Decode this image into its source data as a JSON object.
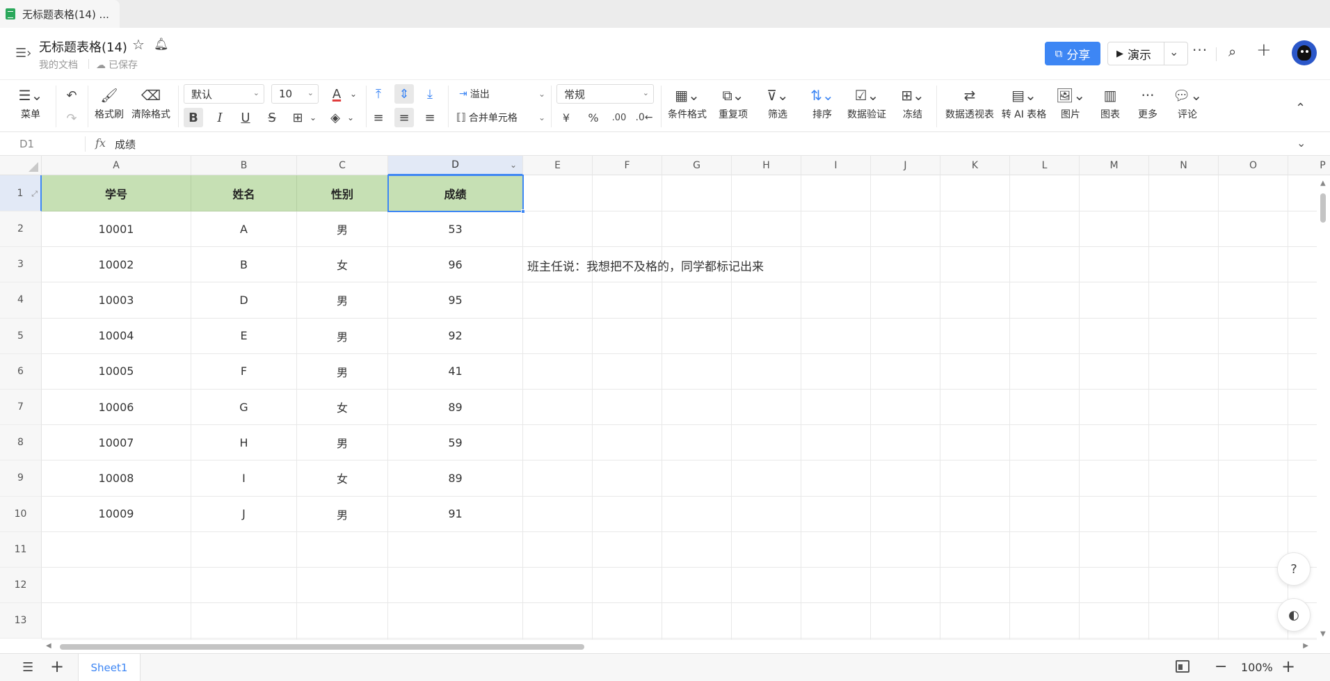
{
  "browser_tab": {
    "title": "无标题表格(14) ..."
  },
  "doc": {
    "title": "无标题表格(14)",
    "breadcrumb": "我的文档",
    "save_status": "已保存"
  },
  "header_actions": {
    "share_label": "分享",
    "present_label": "演示"
  },
  "toolbar": {
    "menu": "菜单",
    "format_painter": "格式刷",
    "clear_format": "清除格式",
    "font_family": "默认",
    "font_size": "10",
    "overflow": "溢出",
    "merge_cells": "合并单元格",
    "number_format": "常规",
    "currency_symbol": "¥",
    "percent_symbol": "%",
    "decimal_more": ".00",
    "conditional_format": "条件格式",
    "duplicates": "重复项",
    "filter": "筛选",
    "sort": "排序",
    "data_validation": "数据验证",
    "freeze": "冻结",
    "pivot_table": "数据透视表",
    "to_ai_table": "转 AI 表格",
    "image": "图片",
    "chart": "图表",
    "more": "更多",
    "comment": "评论"
  },
  "formula_bar": {
    "cell_ref": "D1",
    "value": "成绩"
  },
  "sheet": {
    "columns": [
      "A",
      "B",
      "C",
      "D",
      "E",
      "F",
      "G",
      "H",
      "I",
      "J",
      "K",
      "L",
      "M",
      "N",
      "O",
      "P"
    ],
    "rows": [
      "1",
      "2",
      "3",
      "4",
      "5",
      "6",
      "7",
      "8",
      "9",
      "10",
      "11",
      "12",
      "13"
    ],
    "headers": [
      "学号",
      "姓名",
      "性别",
      "成绩"
    ],
    "data": [
      [
        "10001",
        "A",
        "男",
        "53"
      ],
      [
        "10002",
        "B",
        "女",
        "96"
      ],
      [
        "10003",
        "D",
        "男",
        "95"
      ],
      [
        "10004",
        "E",
        "男",
        "92"
      ],
      [
        "10005",
        "F",
        "男",
        "41"
      ],
      [
        "10006",
        "G",
        "女",
        "89"
      ],
      [
        "10007",
        "H",
        "男",
        "59"
      ],
      [
        "10008",
        "I",
        "女",
        "89"
      ],
      [
        "10009",
        "J",
        "男",
        "91"
      ]
    ],
    "note": "班主任说：我想把不及格的，同学都标记出来"
  },
  "sheet_tabs": {
    "active": "Sheet1"
  },
  "zoom": {
    "level": "100%"
  },
  "colors": {
    "accent": "#3d86f4",
    "header_fill": "#c6e0b4",
    "selection_header": "#e2e9f6"
  }
}
